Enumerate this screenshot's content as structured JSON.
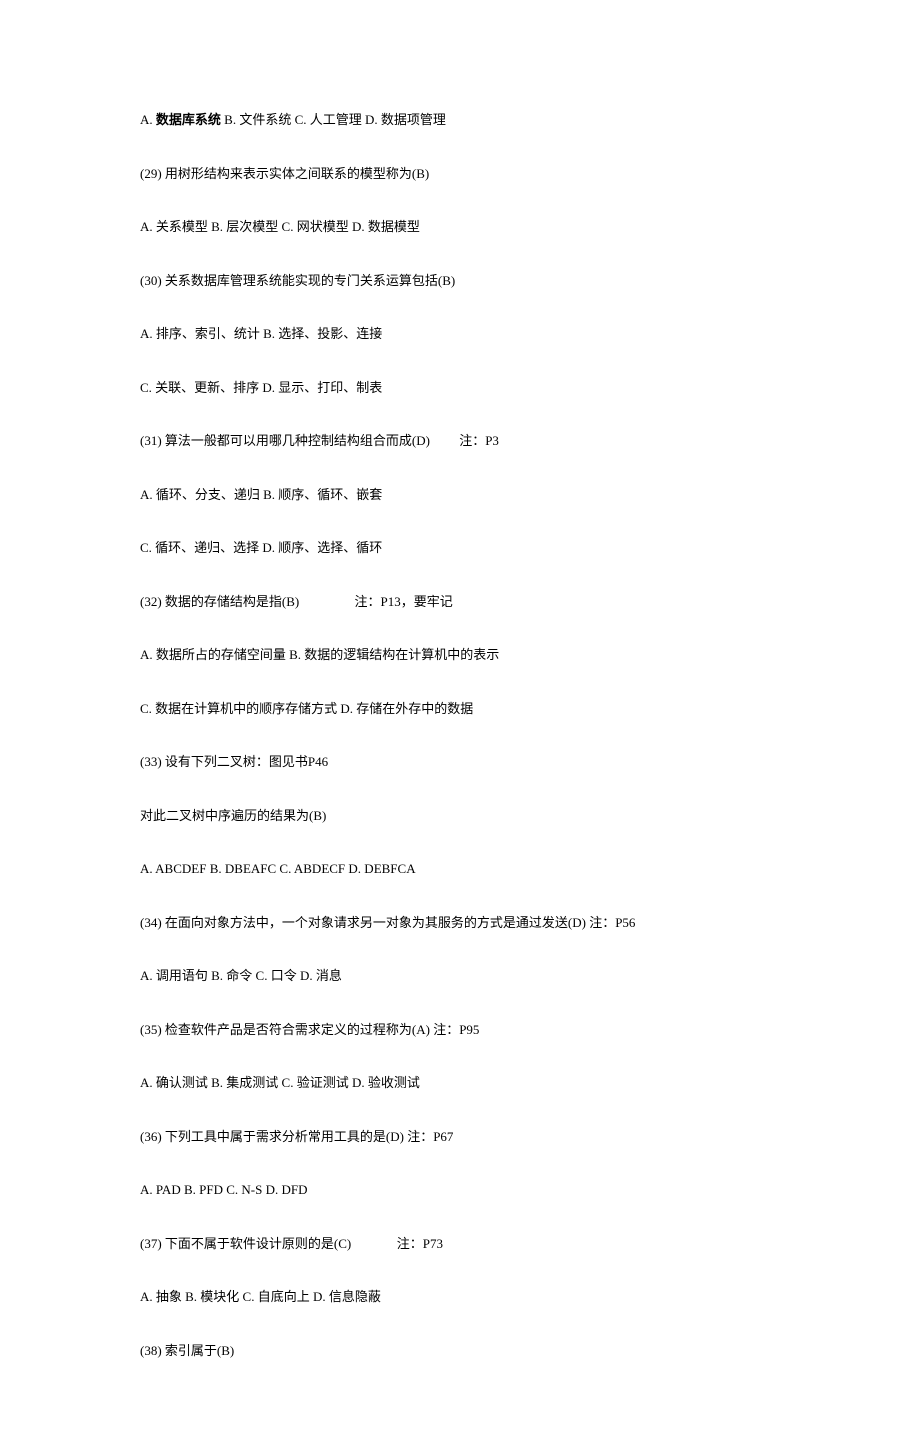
{
  "lines": [
    {
      "segments": [
        {
          "text": "A. ",
          "bold": false
        },
        {
          "text": "数据库系统",
          "bold": true
        },
        {
          "text": " B. 文件系统 C. 人工管理 D. 数据项管理",
          "bold": false
        }
      ]
    },
    {
      "segments": [
        {
          "text": "(29) 用树形结构来表示实体之间联系的模型称为(B)",
          "bold": false
        }
      ]
    },
    {
      "segments": [
        {
          "text": "A. 关系模型 B. 层次模型 C. 网状模型 D. 数据模型",
          "bold": false
        }
      ]
    },
    {
      "segments": [
        {
          "text": "(30) 关系数据库管理系统能实现的专门关系运算包括(B)",
          "bold": false
        }
      ]
    },
    {
      "segments": [
        {
          "text": "A. 排序、索引、统计 B. 选择、投影、连接",
          "bold": false
        }
      ]
    },
    {
      "segments": [
        {
          "text": "C. 关联、更新、排序 D. 显示、打印、制表",
          "bold": false
        }
      ]
    },
    {
      "segments": [
        {
          "text": "(31) 算法一般都可以用哪几种控制结构组合而成(D)　　 注：P3",
          "bold": false
        }
      ]
    },
    {
      "segments": [
        {
          "text": "A. 循环、分支、递归 B. 顺序、循环、嵌套",
          "bold": false
        }
      ]
    },
    {
      "segments": [
        {
          "text": "C. 循环、递归、选择 D. 顺序、选择、循环",
          "bold": false
        }
      ]
    },
    {
      "segments": [
        {
          "text": "(32) 数据的存储结构是指(B) 　　　　注：P13，要牢记",
          "bold": false
        }
      ]
    },
    {
      "segments": [
        {
          "text": "A. 数据所占的存储空间量 B. 数据的逻辑结构在计算机中的表示",
          "bold": false
        }
      ]
    },
    {
      "segments": [
        {
          "text": "C. 数据在计算机中的顺序存储方式 D. 存储在外存中的数据",
          "bold": false
        }
      ]
    },
    {
      "segments": [
        {
          "text": "(33) 设有下列二叉树：图见书P46",
          "bold": false
        }
      ]
    },
    {
      "segments": [
        {
          "text": "对此二叉树中序遍历的结果为(B)",
          "bold": false
        }
      ]
    },
    {
      "segments": [
        {
          "text": "A. ABCDEF B. DBEAFC C. ABDECF D. DEBFCA",
          "bold": false
        }
      ]
    },
    {
      "segments": [
        {
          "text": "(34) 在面向对象方法中，一个对象请求另一对象为其服务的方式是通过发送(D) 注：P56",
          "bold": false
        }
      ]
    },
    {
      "segments": [
        {
          "text": "A. 调用语句 B. 命令 C. 口令 D. 消息",
          "bold": false
        }
      ]
    },
    {
      "segments": [
        {
          "text": "(35) 检查软件产品是否符合需求定义的过程称为(A) 注：P95",
          "bold": false
        }
      ]
    },
    {
      "segments": [
        {
          "text": "A. 确认测试 B. 集成测试 C. 验证测试 D. 验收测试",
          "bold": false
        }
      ]
    },
    {
      "segments": [
        {
          "text": "(36) 下列工具中属于需求分析常用工具的是(D) 注：P67",
          "bold": false
        }
      ]
    },
    {
      "segments": [
        {
          "text": "A. PAD B. PFD C. N-S D. DFD",
          "bold": false
        }
      ]
    },
    {
      "segments": [
        {
          "text": "(37) 下面不属于软件设计原则的是(C) 　　　 注：P73",
          "bold": false
        }
      ]
    },
    {
      "segments": [
        {
          "text": "A. 抽象 B. 模块化 C. 自底向上 D. 信息隐蔽",
          "bold": false
        }
      ]
    },
    {
      "segments": [
        {
          "text": "(38) 索引属于(B)",
          "bold": false
        }
      ]
    }
  ]
}
